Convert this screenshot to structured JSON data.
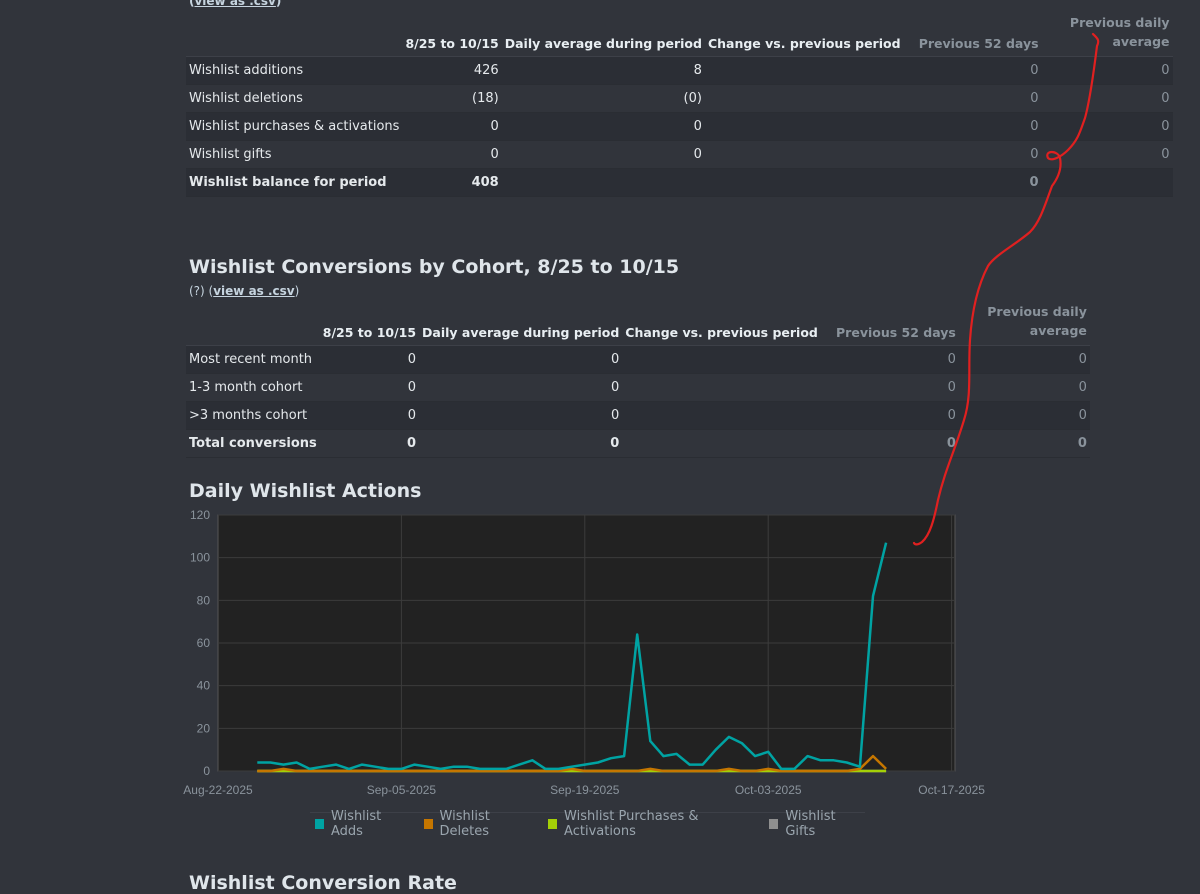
{
  "top": {
    "csv_link": "view as .csv",
    "columns": [
      "",
      "8/25 to 10/15",
      "Daily average during period",
      "Change vs. previous period",
      "Previous 52 days",
      "Previous daily average"
    ],
    "rows": [
      {
        "label": "Wishlist additions",
        "period": "426",
        "avg": "8",
        "change": "",
        "prev": "0",
        "prev_avg": "0"
      },
      {
        "label": "Wishlist deletions",
        "period": "(18)",
        "avg": "(0)",
        "change": "",
        "prev": "0",
        "prev_avg": "0"
      },
      {
        "label": "Wishlist purchases & activations",
        "period": "0",
        "avg": "0",
        "change": "",
        "prev": "0",
        "prev_avg": "0"
      },
      {
        "label": "Wishlist gifts",
        "period": "0",
        "avg": "0",
        "change": "",
        "prev": "0",
        "prev_avg": "0"
      },
      {
        "label": "Wishlist balance for period",
        "period": "408",
        "avg": "",
        "change": "",
        "prev": "0",
        "prev_avg": ""
      }
    ]
  },
  "conversions": {
    "title": "Wishlist Conversions by Cohort, 8/25 to 10/15",
    "help": "(?)",
    "csv_link": "view as .csv",
    "columns": [
      "",
      "8/25 to 10/15",
      "Daily average during period",
      "Change vs. previous period",
      "Previous 52 days",
      "Previous daily average"
    ],
    "rows": [
      {
        "label": "Most recent month",
        "period": "0",
        "avg": "0",
        "change": "",
        "prev": "0",
        "prev_avg": "0"
      },
      {
        "label": "1-3 month cohort",
        "period": "0",
        "avg": "0",
        "change": "",
        "prev": "0",
        "prev_avg": "0"
      },
      {
        "label": ">3 months cohort",
        "period": "0",
        "avg": "0",
        "change": "",
        "prev": "0",
        "prev_avg": "0"
      },
      {
        "label": "Total conversions",
        "period": "0",
        "avg": "0",
        "change": "",
        "prev": "0",
        "prev_avg": "0"
      }
    ]
  },
  "daily": {
    "title": "Daily Wishlist Actions"
  },
  "chart_data": {
    "type": "line",
    "title": "Daily Wishlist Actions",
    "ylim": [
      0,
      120
    ],
    "y_ticks": [
      0,
      20,
      40,
      60,
      80,
      100,
      120
    ],
    "x_tick_labels": [
      "Aug-22-2025",
      "Sep-05-2025",
      "Sep-19-2025",
      "Oct-03-2025",
      "Oct-17-2025"
    ],
    "x_start": "2025-08-25",
    "grid": true,
    "legend_position": "bottom",
    "series": [
      {
        "name": "Wishlist Adds",
        "color": "#00a3a3",
        "values": [
          4,
          4,
          3,
          4,
          1,
          2,
          3,
          1,
          3,
          2,
          1,
          1,
          3,
          2,
          1,
          2,
          2,
          1,
          1,
          1,
          3,
          5,
          1,
          1,
          2,
          3,
          4,
          6,
          7,
          64,
          14,
          7,
          8,
          3,
          3,
          10,
          16,
          13,
          7,
          9,
          1,
          1,
          7,
          5,
          5,
          4,
          2,
          82,
          107
        ]
      },
      {
        "name": "Wishlist Deletes",
        "color": "#c57600",
        "values": [
          0,
          0,
          1,
          0,
          0,
          0,
          0,
          0,
          0,
          0,
          0,
          0,
          0,
          0,
          0,
          0,
          0,
          0,
          0,
          0,
          0,
          0,
          0,
          0,
          1,
          0,
          0,
          0,
          0,
          0,
          1,
          0,
          0,
          0,
          0,
          0,
          1,
          0,
          0,
          1,
          0,
          0,
          0,
          0,
          0,
          0,
          1,
          7,
          1
        ]
      },
      {
        "name": "Wishlist Purchases & Activations",
        "color": "#a4d007",
        "values": [
          0,
          0,
          0,
          0,
          0,
          0,
          0,
          0,
          0,
          0,
          0,
          0,
          0,
          0,
          0,
          0,
          0,
          0,
          0,
          0,
          0,
          0,
          0,
          0,
          0,
          0,
          0,
          0,
          0,
          0,
          0,
          0,
          0,
          0,
          0,
          0,
          0,
          0,
          0,
          0,
          0,
          0,
          0,
          0,
          0,
          0,
          0,
          0,
          0
        ]
      },
      {
        "name": "Wishlist Gifts",
        "color": "#8f8f8f",
        "values": [
          0,
          0,
          0,
          0,
          0,
          0,
          0,
          0,
          0,
          0,
          0,
          0,
          0,
          0,
          0,
          0,
          0,
          0,
          0,
          0,
          0,
          0,
          0,
          0,
          0,
          0,
          0,
          0,
          0,
          0,
          0,
          0,
          0,
          0,
          0,
          0,
          0,
          0,
          0,
          0,
          0,
          0,
          0,
          0,
          0,
          0,
          0,
          0,
          0
        ]
      }
    ]
  },
  "next_section": {
    "title": "Wishlist Conversion Rate"
  },
  "colors": {
    "background": "#31343b",
    "plot_bg": "#222222",
    "annotation": "#e02020"
  }
}
